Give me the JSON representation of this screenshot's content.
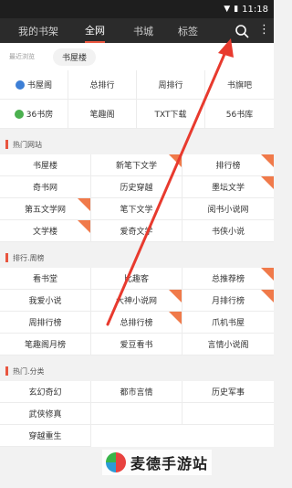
{
  "statusbar": {
    "time": "11:18",
    "icons": [
      "signal-icon",
      "battery-icon"
    ]
  },
  "tabs": [
    {
      "label": "我的书架",
      "active": false
    },
    {
      "label": "全网",
      "active": true
    },
    {
      "label": "书城",
      "active": false
    },
    {
      "label": "标签",
      "active": false
    }
  ],
  "recent": {
    "label": "最近浏览",
    "item": "书屋楼"
  },
  "sources": [
    {
      "label": "书屋阁",
      "icon": "blue-dot"
    },
    {
      "label": "总排行",
      "icon": ""
    },
    {
      "label": "周排行",
      "icon": ""
    },
    {
      "label": "书旗吧",
      "icon": ""
    },
    {
      "label": "36书房",
      "icon": "green-dot"
    },
    {
      "label": "笔趣阁",
      "icon": ""
    },
    {
      "label": "TXT下载",
      "icon": ""
    },
    {
      "label": "56书库",
      "icon": ""
    }
  ],
  "sections": [
    {
      "title": "热门网站",
      "items": [
        {
          "label": "书屋楼",
          "badge": false
        },
        {
          "label": "新笔下文学",
          "badge": true
        },
        {
          "label": "排行榜",
          "badge": true
        },
        {
          "label": "奇书网",
          "badge": false
        },
        {
          "label": "历史穿越",
          "badge": false
        },
        {
          "label": "墨坛文学",
          "badge": true
        },
        {
          "label": "第五文学网",
          "badge": true
        },
        {
          "label": "笔下文学",
          "badge": false
        },
        {
          "label": "阅书小说网",
          "badge": false
        },
        {
          "label": "文学楼",
          "badge": true
        },
        {
          "label": "爱奇文学",
          "badge": false
        },
        {
          "label": "书侠小说",
          "badge": false
        }
      ]
    },
    {
      "title": "排行.周榜",
      "items": [
        {
          "label": "看书堂",
          "badge": false
        },
        {
          "label": "比趣客",
          "badge": false
        },
        {
          "label": "总推荐榜",
          "badge": true
        },
        {
          "label": "我爱小说",
          "badge": false
        },
        {
          "label": "大神小说网",
          "badge": true
        },
        {
          "label": "月排行榜",
          "badge": true
        },
        {
          "label": "周排行榜",
          "badge": false
        },
        {
          "label": "总排行榜",
          "badge": true
        },
        {
          "label": "爪机书屋",
          "badge": false
        },
        {
          "label": "笔趣阁月榜",
          "badge": false
        },
        {
          "label": "爱豆看书",
          "badge": false
        },
        {
          "label": "言情小说阁",
          "badge": false
        }
      ]
    },
    {
      "title": "热门.分类",
      "items": [
        {
          "label": "玄幻奇幻",
          "badge": false
        },
        {
          "label": "都市言情",
          "badge": false
        },
        {
          "label": "历史军事",
          "badge": false
        },
        {
          "label": "武侠修真",
          "badge": false
        },
        {
          "label": "",
          "badge": false
        },
        {
          "label": "",
          "badge": false
        },
        {
          "label": "穿越重生",
          "badge": false
        }
      ]
    }
  ],
  "watermark": {
    "text": "麦德手游站"
  },
  "colors": {
    "accent": "#e8553f",
    "topbar": "#2b2b2b",
    "arrow": "#e83a2e"
  }
}
